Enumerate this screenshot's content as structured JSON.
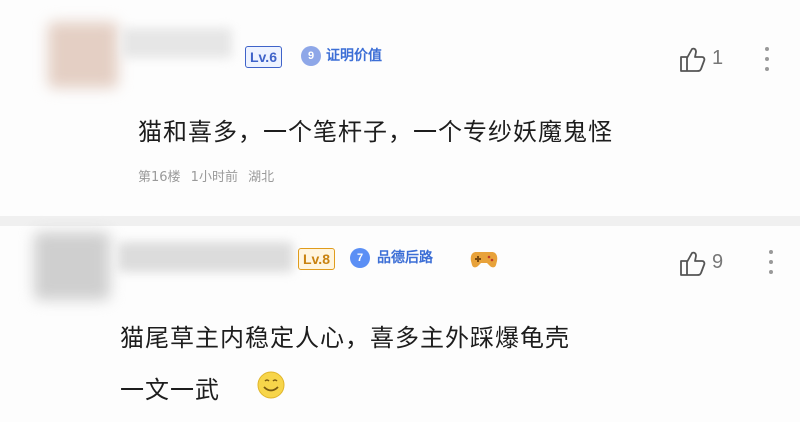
{
  "colors": {
    "level_badge_1": "#3f63c9",
    "level_badge_2": "#e09c1c",
    "medal_blue": "#5b8ff5",
    "medal_text": "#3d6fd6",
    "meta_gray": "#9a9a9a"
  },
  "comments": [
    {
      "level": "Lv.6",
      "medal_number": "9",
      "medal_title": "证明价值",
      "text": "猫和喜多，一个笔杆子，一个专纱妖魔鬼怪",
      "meta": "第16楼  1小时前  湖北",
      "likes": "1",
      "like_icon": "thumbs-up-icon",
      "more_icon": "more-vertical-icon"
    },
    {
      "level": "Lv.8",
      "medal_number": "7",
      "medal_title": "品德后路",
      "text_line1": "猫尾草主内稳定人心，喜多主外踩爆龟壳",
      "text_line2": "一文一武",
      "likes": "9",
      "extra_badge_icon": "game-controller-icon",
      "emoji_icon": "smile-emoji-icon",
      "like_icon": "thumbs-up-icon",
      "more_icon": "more-vertical-icon"
    }
  ]
}
